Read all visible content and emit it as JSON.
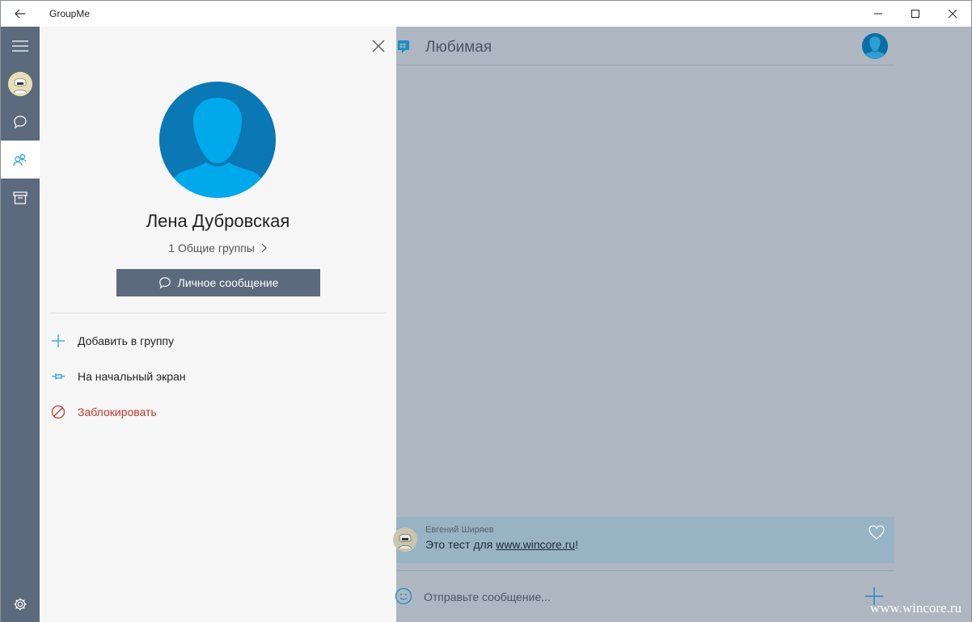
{
  "window": {
    "title": "GroupMe",
    "back_icon": "back-arrow-icon",
    "controls": [
      "minimize-icon",
      "maximize-icon",
      "close-icon"
    ]
  },
  "rail": {
    "items": [
      {
        "name": "menu",
        "icon": "hamburger-icon"
      },
      {
        "name": "profile",
        "icon": "avatar"
      },
      {
        "name": "chats",
        "icon": "chat-bubble-icon"
      },
      {
        "name": "contacts",
        "icon": "contacts-icon",
        "active": true
      },
      {
        "name": "archive",
        "icon": "archive-icon"
      }
    ],
    "settings_icon": "gear-icon"
  },
  "profile_panel": {
    "name": "Лена Дубровская",
    "common_groups": "1 Общие группы",
    "dm_button": "Личное сообщение",
    "actions": [
      {
        "label": "Добавить в группу",
        "icon": "plus-icon",
        "color": "#1fa3d9"
      },
      {
        "label": "На начальный экран",
        "icon": "pin-icon",
        "color": "#1fa3d9"
      },
      {
        "label": "Заблокировать",
        "icon": "block-icon",
        "color": "#c0392b"
      }
    ]
  },
  "chat": {
    "title": "Любимая",
    "message": {
      "author": "Евгений Ширяев",
      "text_prefix": "Это тест для ",
      "link": "www.wincore.ru",
      "text_suffix": "!"
    },
    "compose_placeholder": "Отправьте сообщение...",
    "watermark": "www.wincore.ru"
  },
  "colors": {
    "rail": "#5c6a7e",
    "accent": "#1fa3d9",
    "avatar_blue": "#0a78b4",
    "danger": "#c0392b",
    "overlay": "#aeb6c1"
  }
}
